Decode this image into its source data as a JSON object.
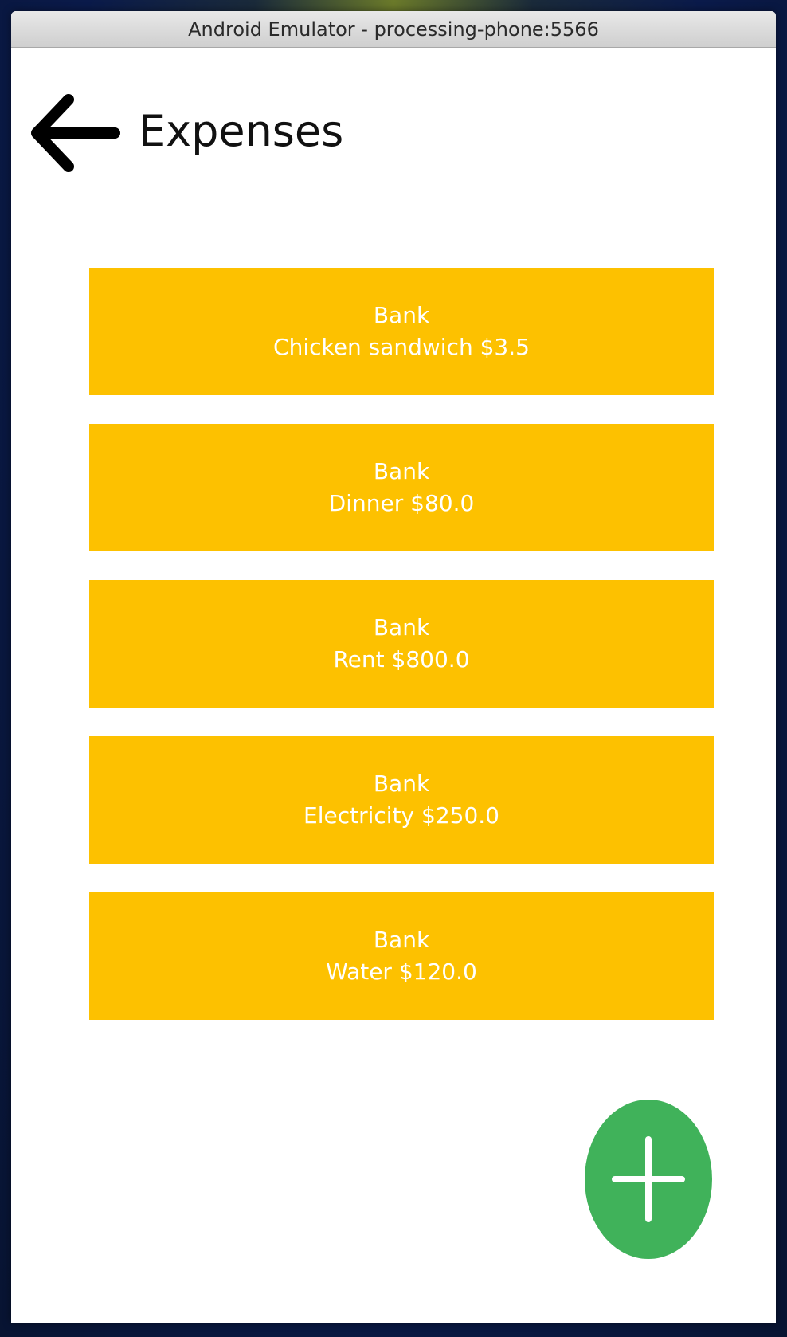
{
  "window": {
    "title": "Android Emulator - processing-phone:5566"
  },
  "header": {
    "title": "Expenses",
    "back_icon": "arrow-left-icon"
  },
  "expenses": [
    {
      "account": "Bank",
      "detail": "Chicken sandwich $3.5"
    },
    {
      "account": "Bank",
      "detail": "Dinner $80.0"
    },
    {
      "account": "Bank",
      "detail": "Rent $800.0"
    },
    {
      "account": "Bank",
      "detail": "Electricity $250.0"
    },
    {
      "account": "Bank",
      "detail": "Water $120.0"
    }
  ],
  "fab": {
    "icon": "plus-icon"
  },
  "colors": {
    "card": "#FDC100",
    "card_text": "#FFFFFF",
    "fab": "#40B25A",
    "fab_icon": "#FFFFFF"
  }
}
